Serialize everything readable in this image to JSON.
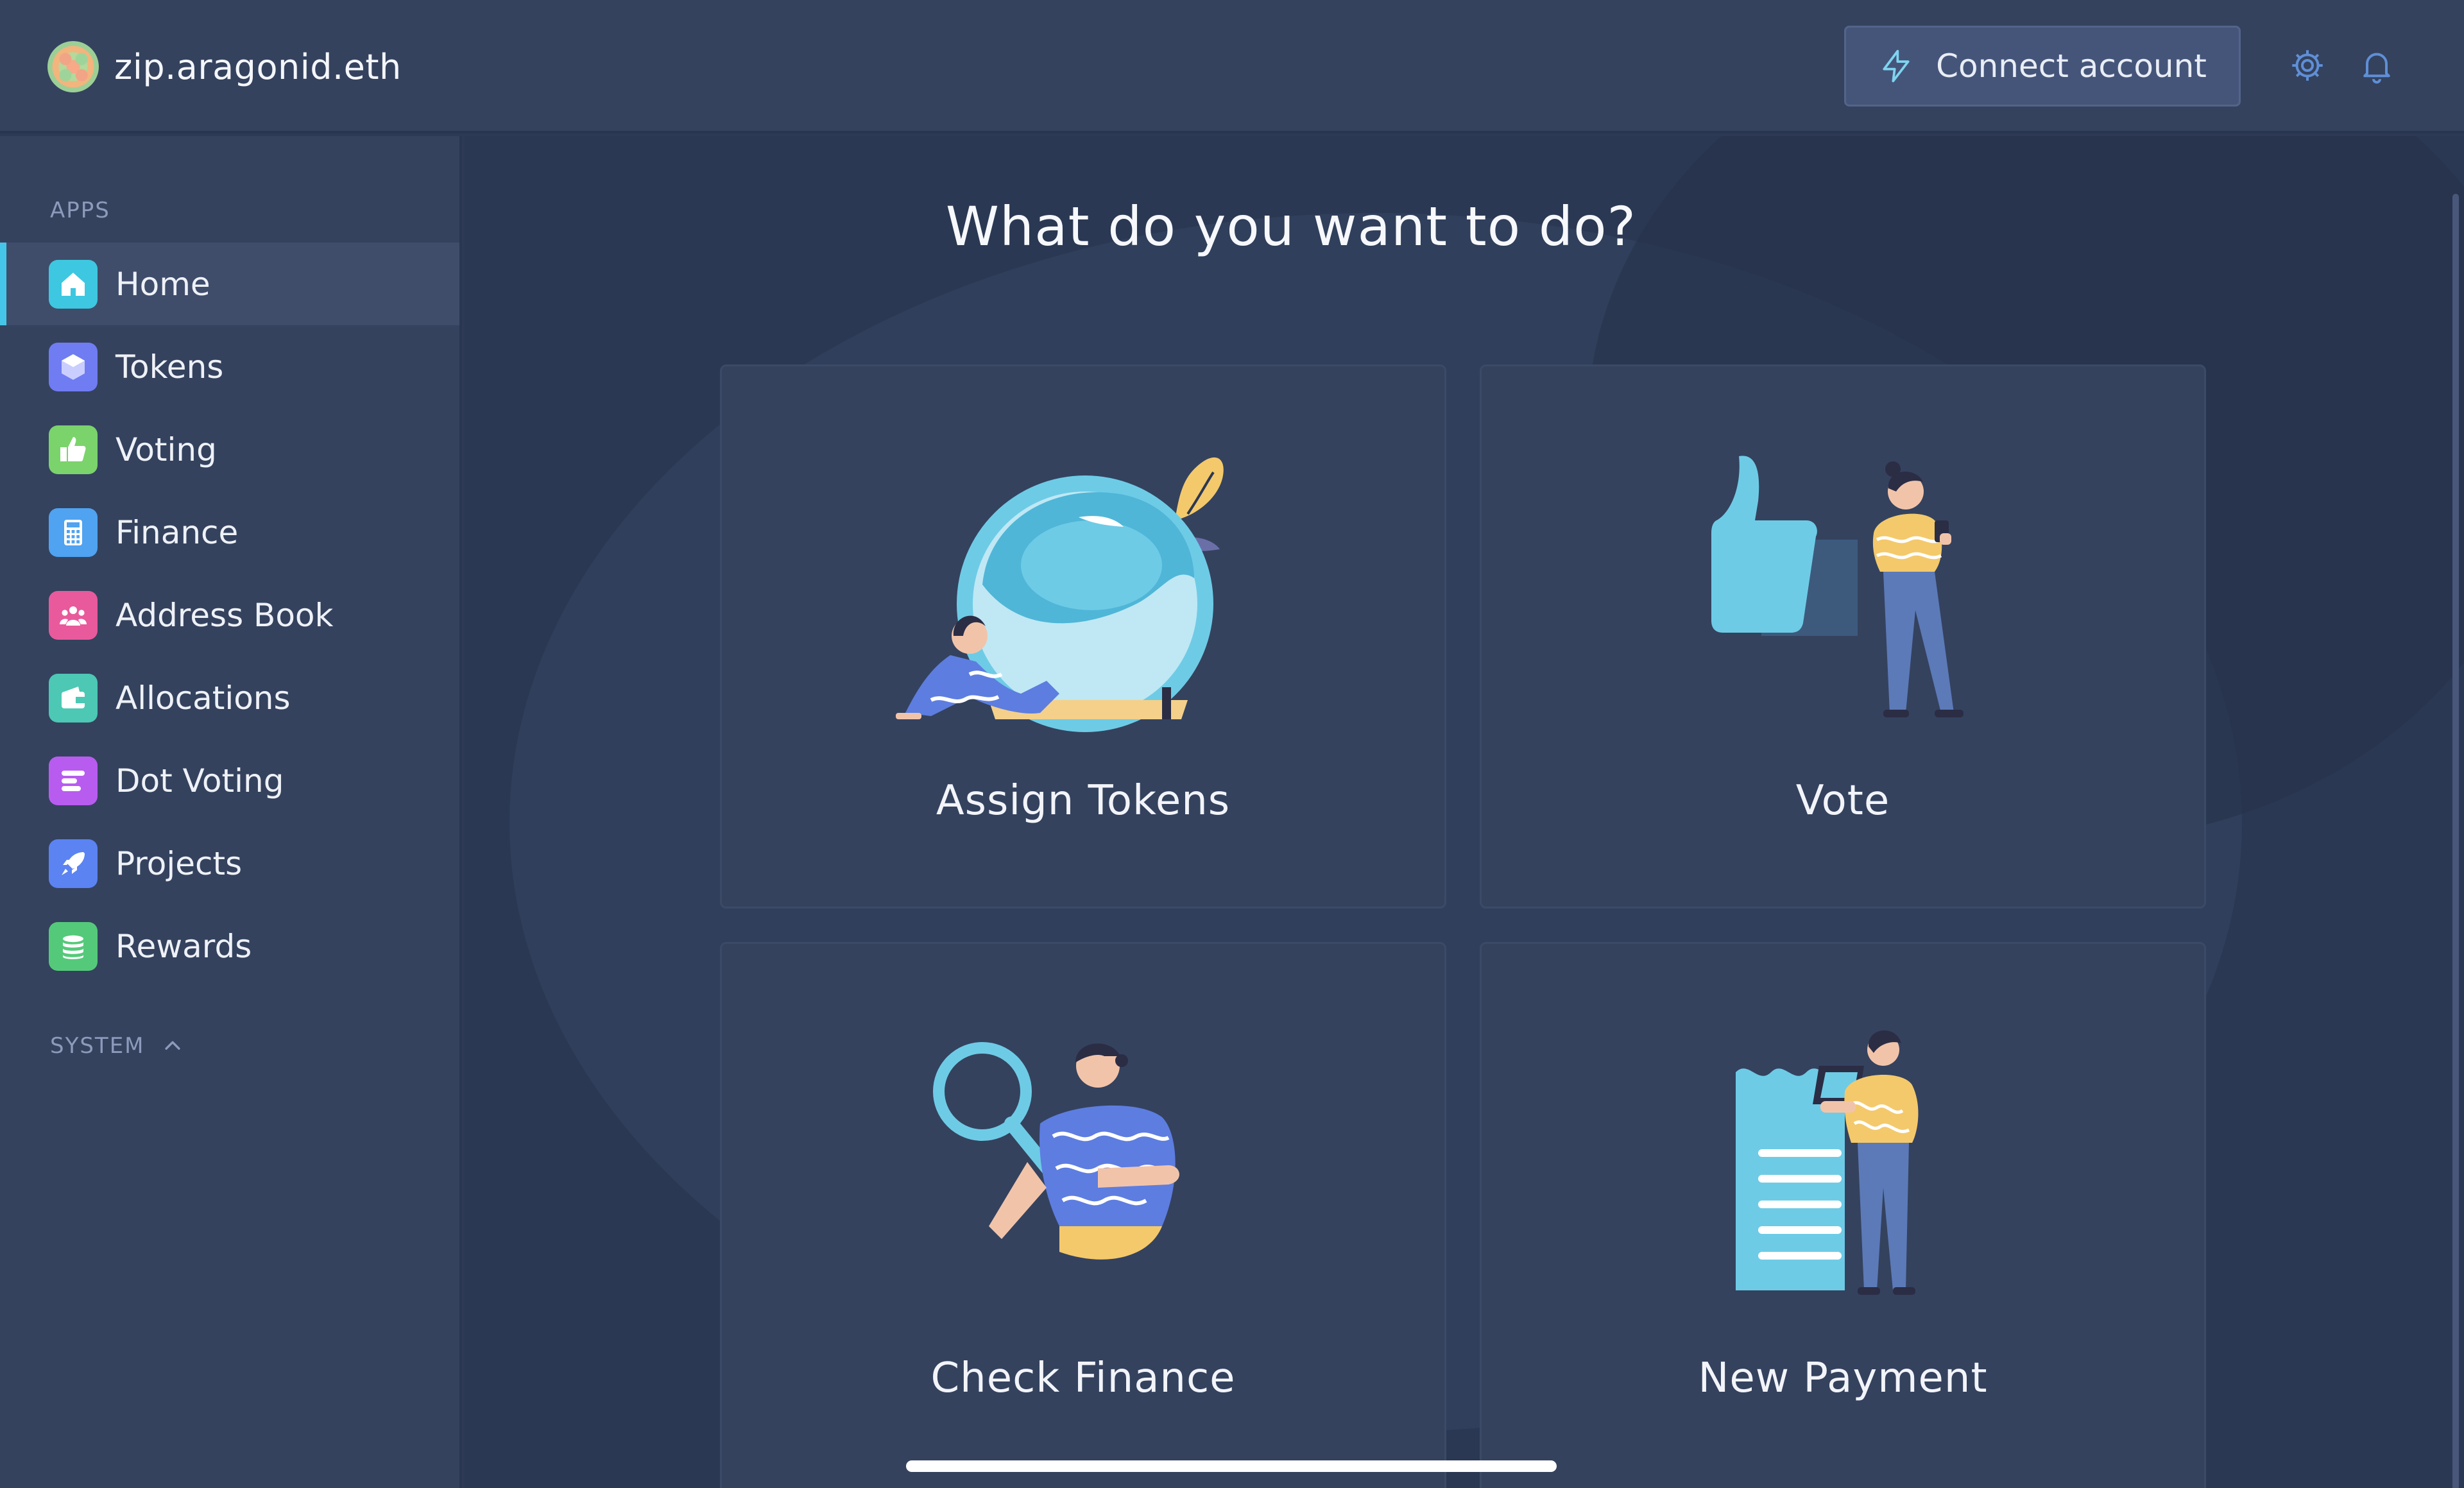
{
  "topbar": {
    "org_name": "zip.aragonid.eth",
    "connect_label": "Connect account",
    "icons": [
      "bolt-icon",
      "gear-icon",
      "bell-icon"
    ]
  },
  "sidebar": {
    "apps_label": "APPS",
    "system_label": "SYSTEM",
    "items": [
      {
        "label": "Home",
        "icon": "home-icon",
        "color": "#3ec7e0",
        "active": true
      },
      {
        "label": "Tokens",
        "icon": "tokens-icon",
        "color": "#6f7cf2"
      },
      {
        "label": "Voting",
        "icon": "voting-icon",
        "color": "#7bd36c"
      },
      {
        "label": "Finance",
        "icon": "finance-icon",
        "color": "#4fa3f0"
      },
      {
        "label": "Address Book",
        "icon": "address-book-icon",
        "color": "#e85a9c"
      },
      {
        "label": "Allocations",
        "icon": "allocations-icon",
        "color": "#4cc8b5"
      },
      {
        "label": "Dot Voting",
        "icon": "dot-voting-icon",
        "color": "#b85cf0"
      },
      {
        "label": "Projects",
        "icon": "projects-icon",
        "color": "#5b83f2"
      },
      {
        "label": "Rewards",
        "icon": "rewards-icon",
        "color": "#55c97a"
      }
    ]
  },
  "main": {
    "headline": "What do you want to do?",
    "cards": [
      {
        "label": "Assign Tokens",
        "icon": "assign-tokens-illustration"
      },
      {
        "label": "Vote",
        "icon": "vote-illustration"
      },
      {
        "label": "Check Finance",
        "icon": "check-finance-illustration"
      },
      {
        "label": "New Payment",
        "icon": "new-payment-illustration"
      }
    ]
  },
  "colors": {
    "accent": "#45c6e8",
    "background": "#2b3853",
    "panel": "#34425e"
  }
}
